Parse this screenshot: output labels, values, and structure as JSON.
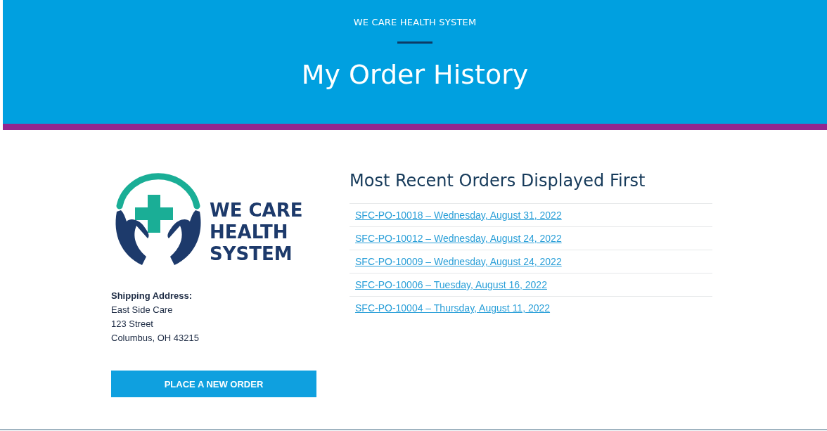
{
  "header": {
    "eyebrow": "WE CARE HEALTH SYSTEM",
    "title": "My Order History"
  },
  "logo": {
    "lines": [
      "WE CARE",
      "HEALTH",
      "SYSTEM"
    ]
  },
  "shipping": {
    "label": "Shipping Address:",
    "lines": [
      "East Side Care",
      "123 Street",
      "Columbus, OH 43215"
    ]
  },
  "button": "PLACE A NEW ORDER",
  "orders": {
    "heading": "Most Recent Orders Displayed First",
    "items": [
      "SFC-PO-10018 – Wednesday, August 31, 2022",
      "SFC-PO-10012 – Wednesday, August 24, 2022",
      "SFC-PO-10009 – Wednesday, August 24, 2022",
      "SFC-PO-10006 – Tuesday, August 16, 2022",
      "SFC-PO-10004 – Thursday, August 11, 2022"
    ]
  }
}
